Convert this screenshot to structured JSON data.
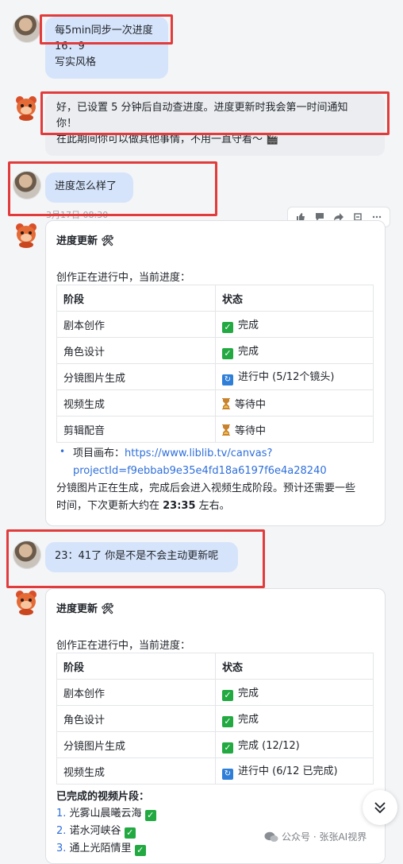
{
  "messages": {
    "user1": {
      "line1": "每5min同步一次进度",
      "line2": "16：9",
      "line3": "写实风格"
    },
    "bot1": {
      "line1": "好，已设置 5 分钟后自动查进度。进度更新时我会第一时间通知",
      "line2": "你！",
      "line3": "在此期间你可以做其他事情，不用一直守着～ 🎬"
    },
    "user2": {
      "text": "进度怎么样了",
      "timestamp": "3月17日 08:30"
    },
    "card1": {
      "title": "进度更新 🛠",
      "intro": "创作正在进行中，当前进度：",
      "header": {
        "stage": "阶段",
        "status": "状态"
      },
      "rows": [
        {
          "stage": "剧本创作",
          "status": "完成",
          "icon": "check-icon"
        },
        {
          "stage": "角色设计",
          "status": "完成",
          "icon": "check-icon"
        },
        {
          "stage": "分镜图片生成",
          "status": "进行中 (5/12个镜头)",
          "icon": "refresh-icon"
        },
        {
          "stage": "视频生成",
          "status": "等待中",
          "icon": "hourglass-icon"
        },
        {
          "stage": "剪辑配音",
          "status": "等待中",
          "icon": "hourglass-icon"
        }
      ],
      "bullet_label": "项目画布：",
      "link_line1": "https://www.liblib.tv/canvas?",
      "link_line2": "projectId=f9ebbab9e35e4fd18a6197f6e4a28240",
      "summary_line1": "分镜图片正在生成，完成后会进入视频生成阶段。预计还需要一些",
      "summary_pre": "时间，下次更新大约在 ",
      "summary_time": "23:35",
      "summary_post": " 左右。"
    },
    "user3": {
      "text": "23：41了 你是不是不会主动更新呢"
    },
    "card2": {
      "title": "进度更新 🛠",
      "intro": "创作正在进行中，当前进度：",
      "header": {
        "stage": "阶段",
        "status": "状态"
      },
      "rows": [
        {
          "stage": "剧本创作",
          "status": "完成",
          "icon": "check-icon"
        },
        {
          "stage": "角色设计",
          "status": "完成",
          "icon": "check-icon"
        },
        {
          "stage": "分镜图片生成",
          "status": "完成 (12/12)",
          "icon": "check-icon"
        },
        {
          "stage": "视频生成",
          "status": "进行中 (6/12 已完成)",
          "icon": "refresh-icon"
        }
      ],
      "done_title": "已完成的视频片段：",
      "done_items": [
        {
          "num": "1.",
          "text": "光雾山晨曦云海"
        },
        {
          "num": "2.",
          "text": "诺水河峡谷"
        },
        {
          "num": "3.",
          "text": "通上光陌情里"
        }
      ]
    }
  },
  "watermark": "公众号 · 张张AI视界",
  "colors": {
    "accent": "#2f6fdb",
    "user_bubble": "#d6e4fb",
    "highlight": "#e23b3b",
    "done": "#23a942"
  }
}
